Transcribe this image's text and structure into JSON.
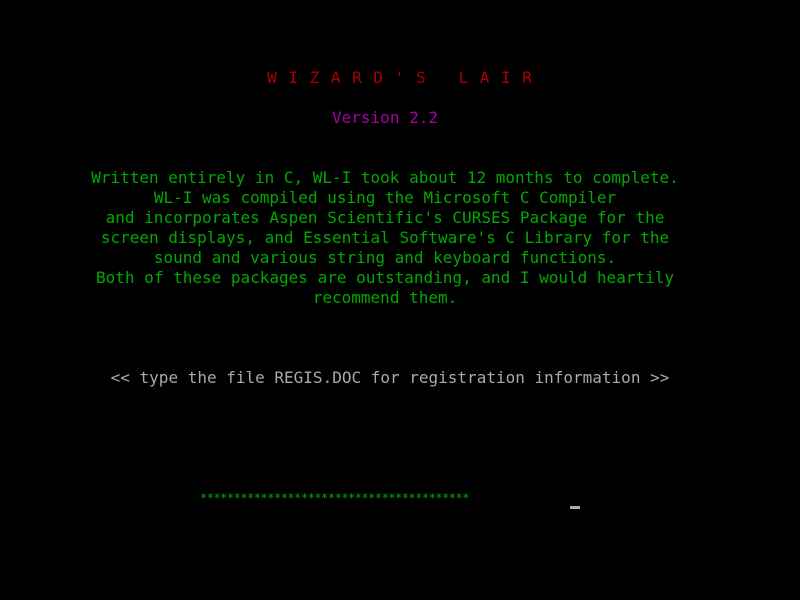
{
  "colors": {
    "background": "#000000",
    "title": "#aa0000",
    "version": "#aa00aa",
    "credits": "#00aa00",
    "prompt": "#aaaaaa",
    "progress": "#00aa00",
    "cursor": "#aaaaaa"
  },
  "title": "W I Z A R D ' S   L A I R",
  "version": "Version 2.2",
  "credits": {
    "lines": [
      "Written entirely in C, WL-I took about 12 months to complete.",
      "WL-I was compiled using the Microsoft C Compiler",
      "and incorporates Aspen Scientific's CURSES Package for the",
      "screen displays, and Essential Software's C Library for the",
      "sound and various string and keyboard functions.",
      "Both of these packages are outstanding, and I would heartily",
      "recommend them."
    ]
  },
  "prompt": "<< type the file REGIS.DOC for registration information >>",
  "progress": {
    "text": "****************************************"
  }
}
